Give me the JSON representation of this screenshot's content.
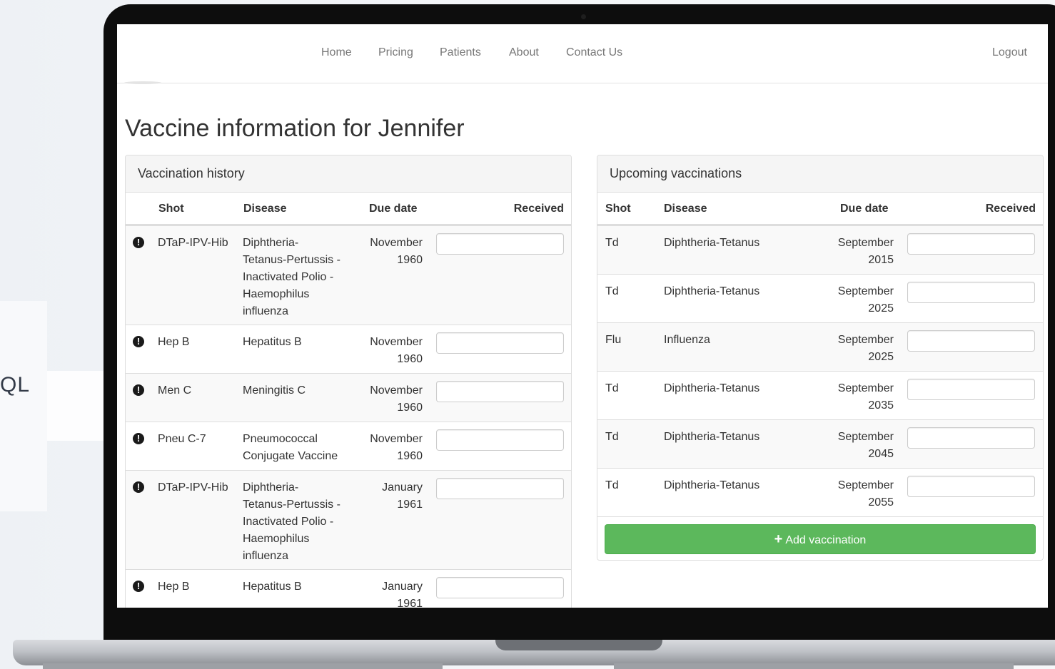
{
  "background_text": "QL",
  "nav": {
    "items": [
      "Home",
      "Pricing",
      "Patients",
      "About",
      "Contact Us"
    ],
    "logout": "Logout"
  },
  "page_title": "Vaccine information for Jennifer",
  "history": {
    "title": "Vaccination history",
    "columns": [
      "Shot",
      "Disease",
      "Due date",
      "Received"
    ],
    "rows": [
      {
        "shot": "DTaP-IPV-Hib",
        "disease": [
          "Diphtheria-",
          "Tetanus-Pertussis -",
          "Inactivated Polio -",
          "Haemophilus",
          "influenza"
        ],
        "due": [
          "November",
          "1960"
        ],
        "warning": "!"
      },
      {
        "shot": "Hep B",
        "disease": [
          "Hepatitus B"
        ],
        "due": [
          "November",
          "1960"
        ],
        "warning": "!"
      },
      {
        "shot": "Men C",
        "disease": [
          "Meningitis C"
        ],
        "due": [
          "November",
          "1960"
        ],
        "warning": "!"
      },
      {
        "shot": "Pneu C-7",
        "disease": [
          "Pneumococcal",
          "Conjugate Vaccine"
        ],
        "due": [
          "November",
          "1960"
        ],
        "warning": "!"
      },
      {
        "shot": "DTaP-IPV-Hib",
        "disease": [
          "Diphtheria-",
          "Tetanus-Pertussis -",
          "Inactivated Polio -",
          "Haemophilus",
          "influenza"
        ],
        "due": [
          "January",
          "1961"
        ],
        "warning": "!"
      },
      {
        "shot": "Hep B",
        "disease": [
          "Hepatitus B"
        ],
        "due": [
          "January",
          "1961"
        ],
        "warning": "!"
      }
    ]
  },
  "upcoming": {
    "title": "Upcoming vaccinations",
    "columns": [
      "Shot",
      "Disease",
      "Due date",
      "Received"
    ],
    "rows": [
      {
        "shot": "Td",
        "disease": "Diphtheria-Tetanus",
        "due": [
          "September",
          "2015"
        ]
      },
      {
        "shot": "Td",
        "disease": "Diphtheria-Tetanus",
        "due": [
          "September",
          "2025"
        ]
      },
      {
        "shot": "Flu",
        "disease": "Influenza",
        "due": [
          "September",
          "2025"
        ]
      },
      {
        "shot": "Td",
        "disease": "Diphtheria-Tetanus",
        "due": [
          "September",
          "2035"
        ]
      },
      {
        "shot": "Td",
        "disease": "Diphtheria-Tetanus",
        "due": [
          "September",
          "2045"
        ]
      },
      {
        "shot": "Td",
        "disease": "Diphtheria-Tetanus",
        "due": [
          "September",
          "2055"
        ]
      }
    ],
    "add_button": "Add vaccination",
    "add_icon": "+"
  },
  "colors": {
    "success_button": "#5cb85c",
    "panel_heading": "#f5f5f5",
    "stripe": "#f9f9f9"
  }
}
